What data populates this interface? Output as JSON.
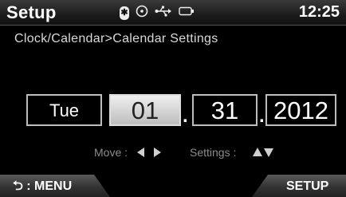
{
  "header": {
    "title": "Setup",
    "time": "12:25",
    "icons": [
      "bluetooth-icon",
      "disc-icon",
      "usb-icon",
      "battery-icon"
    ]
  },
  "breadcrumb": "Clock/Calendar>Calendar Settings",
  "date": {
    "day_of_week": "Tue",
    "month": "01",
    "day": "31",
    "year": "2012",
    "separator": "."
  },
  "hints": {
    "move_label": "Move :",
    "settings_label": "Settings :"
  },
  "softkeys": {
    "left_label": "⮌ : MENU",
    "right_label": "SETUP"
  }
}
